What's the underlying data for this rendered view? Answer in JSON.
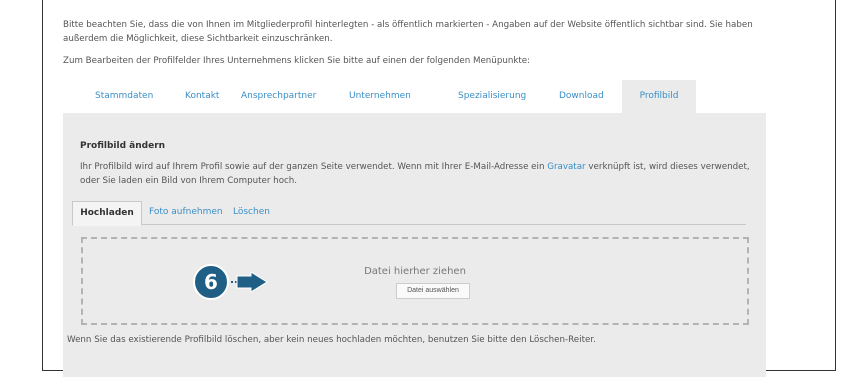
{
  "intro": {
    "line1": "Bitte beachten Sie, dass die von Ihnen im Mitgliederprofil hinterlegten - als öffentlich markierten - Angaben auf der Website öffentlich sichtbar sind. Sie haben außerdem die Möglichkeit, diese Sichtbarkeit einzuschränken.",
    "line2": "Zum Bearbeiten der Profilfelder Ihres Unternehmens klicken Sie bitte auf einen der folgenden Menüpunkte:"
  },
  "tabs": [
    {
      "label": "Stammdaten"
    },
    {
      "label": "Kontakt"
    },
    {
      "label": "Ansprechpartner"
    },
    {
      "label": "Unternehmen"
    },
    {
      "label": "Spezialisierung"
    },
    {
      "label": "Download"
    },
    {
      "label": "Profilbild",
      "active": true
    }
  ],
  "panel": {
    "title": "Profilbild ändern",
    "desc_before": "Ihr Profilbild wird auf Ihrem Profil sowie auf der ganzen Seite verwendet. Wenn mit Ihrer E-Mail-Adresse ein ",
    "desc_link": "Gravatar",
    "desc_after": " verknüpft ist, wird dieses verwendet, oder Sie laden ein Bild von Ihrem Computer hoch.",
    "subtabs": [
      {
        "label": "Hochladen",
        "active": true
      },
      {
        "label": "Foto aufnehmen"
      },
      {
        "label": "Löschen"
      }
    ],
    "dropzone": {
      "text": "Datei hierher ziehen",
      "button": "Datei auswählen"
    },
    "note": "Wenn Sie das existierende Profilbild löschen, aber kein neues hochladen möchten, benutzen Sie bitte den Löschen-Reiter."
  },
  "annotation": {
    "step": "6",
    "color": "#1f5f86"
  },
  "colors": {
    "link": "#3a8fc7",
    "panel_bg": "#ebebeb"
  }
}
